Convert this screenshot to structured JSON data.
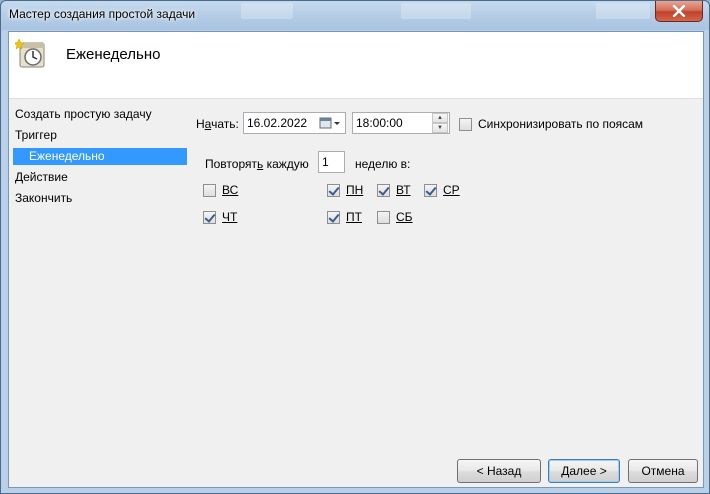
{
  "window": {
    "title": "Мастер создания простой задачи"
  },
  "header": {
    "title": "Еженедельно",
    "icon": "clock-calendar-icon"
  },
  "steps": [
    {
      "label": "Создать простую задачу"
    },
    {
      "label": "Триггер"
    },
    {
      "label": "Еженедельно",
      "active": true
    },
    {
      "label": "Действие"
    },
    {
      "label": "Закончить"
    }
  ],
  "start": {
    "label_pre": "Н",
    "label_u": "а",
    "label_post": "чать:",
    "date": "16.02.2022",
    "time": "18:00:00",
    "sync_label": "Синхронизировать по поясам",
    "sync_checked": false
  },
  "repeat": {
    "label_pre": "Повторят",
    "label_u": "ь",
    "label_post": " каждую",
    "value": "1",
    "suffix": "неделю в:"
  },
  "days": [
    {
      "label": "ВС",
      "checked": false
    },
    {
      "label": "ПН",
      "checked": true
    },
    {
      "label": "ВТ",
      "checked": true
    },
    {
      "label": "СР",
      "checked": true
    },
    {
      "label": "ЧТ",
      "checked": true
    },
    {
      "label": "ПТ",
      "checked": true
    },
    {
      "label": "СБ",
      "checked": false
    }
  ],
  "buttons": {
    "back": "< Назад",
    "next": "Далее >",
    "cancel": "Отмена"
  }
}
